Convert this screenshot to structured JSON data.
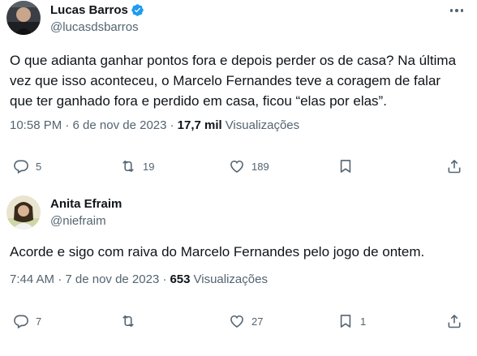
{
  "tweets": [
    {
      "name": "Lucas Barros",
      "verified": true,
      "handle": "@lucasdsbarros",
      "text": "O que adianta ganhar pontos fora e depois perder os de casa? Na última vez que isso aconteceu, o Marcelo Fernandes teve a coragem de falar que ter ganhado fora e perdido em casa, ficou “elas por elas”.",
      "time": "10:58 PM · 6 de nov de 2023 ·",
      "views_count": "17,7 mil",
      "views_label": "Visualizações",
      "replies": "5",
      "retweets": "19",
      "likes": "189",
      "bookmarks": ""
    },
    {
      "name": "Anita Efraim",
      "verified": false,
      "handle": "@niefraim",
      "text": "Acorde e sigo com raiva do Marcelo Fernandes pelo jogo de ontem.",
      "time": "7:44 AM · 7 de nov de 2023 ·",
      "views_count": "653",
      "views_label": "Visualizações",
      "replies": "7",
      "retweets": "",
      "likes": "27",
      "bookmarks": "1"
    }
  ],
  "icons": {
    "verified": "verified-badge-icon",
    "more": "more-dots-icon",
    "reply": "reply-bubble-icon",
    "retweet": "retweet-icon",
    "like": "heart-icon",
    "bookmark": "bookmark-icon",
    "share": "share-icon"
  },
  "colors": {
    "text": "#0f1419",
    "secondary": "#536471",
    "verified": "#1d9bf0"
  }
}
